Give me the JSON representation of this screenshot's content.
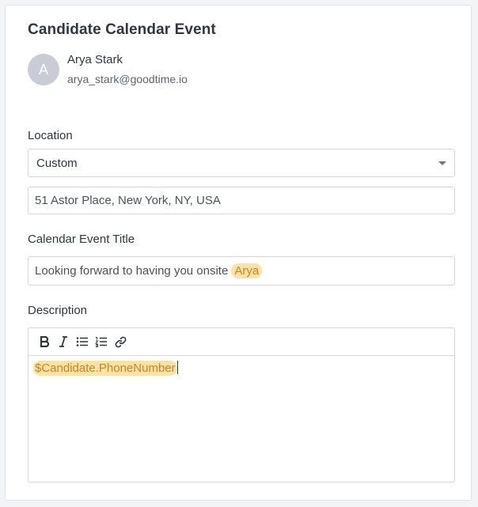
{
  "panel": {
    "title": "Candidate Calendar Event"
  },
  "user": {
    "avatar_initial": "A",
    "name": "Arya Stark",
    "email": "arya_stark@goodtime.io"
  },
  "location": {
    "label": "Location",
    "selected": "Custom",
    "address": "51 Astor Place, New York, NY, USA"
  },
  "event_title": {
    "label": "Calendar Event Title",
    "text": "Looking forward to having you onsite",
    "token": "Arya"
  },
  "description": {
    "label": "Description",
    "toolbar": [
      "bold-icon",
      "italic-icon",
      "bulleted-list-icon",
      "numbered-list-icon",
      "link-icon"
    ],
    "token": "$Candidate.PhoneNumber"
  },
  "colors": {
    "token_background": "#fde3a7",
    "token_text": "#c9861a",
    "border": "#d3d7dd",
    "avatar": "#c9ccd4"
  }
}
